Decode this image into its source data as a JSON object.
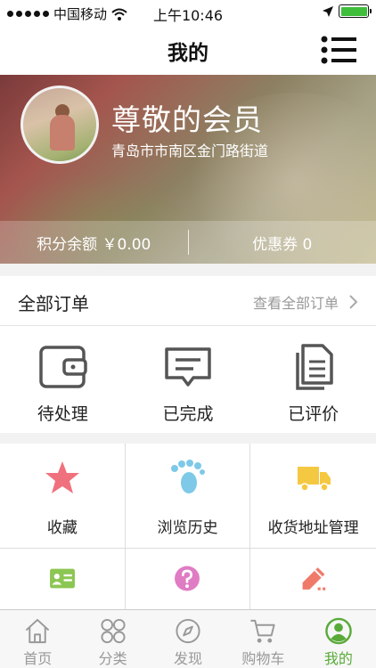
{
  "status_bar": {
    "carrier": "中国移动",
    "time": "上午10:46",
    "wifi_icon": "wifi-icon",
    "location_icon": "location-arrow-icon",
    "battery_icon": "battery-icon",
    "battery_level": 1.0
  },
  "header": {
    "title": "我的",
    "menu_icon": "list-menu-icon"
  },
  "profile": {
    "member_name": "尊敬的会员",
    "address": "青岛市市南区金门路街道",
    "points_balance": "积分余额 ￥0.00",
    "coupons": "优惠券 0"
  },
  "orders": {
    "title": "全部订单",
    "view_all": "查看全部订单",
    "statuses": [
      {
        "label": "待处理",
        "icon": "wallet-icon"
      },
      {
        "label": "已完成",
        "icon": "message-icon"
      },
      {
        "label": "已评价",
        "icon": "documents-icon"
      }
    ]
  },
  "grid": [
    {
      "label": "收藏",
      "icon": "star-icon",
      "color": "#f0717e"
    },
    {
      "label": "浏览历史",
      "icon": "footprint-icon",
      "color": "#7ec9e8"
    },
    {
      "label": "收货地址管理",
      "icon": "truck-icon",
      "color": "#f5c842"
    },
    {
      "label": "",
      "icon": "id-card-icon",
      "color": "#8cc653"
    },
    {
      "label": "",
      "icon": "question-icon",
      "color": "#e07cc4"
    },
    {
      "label": "",
      "icon": "pencil-icon",
      "color": "#f07a6a"
    }
  ],
  "tabs": [
    {
      "label": "首页",
      "icon": "home-icon",
      "active": false
    },
    {
      "label": "分类",
      "icon": "category-icon",
      "active": false
    },
    {
      "label": "发现",
      "icon": "compass-icon",
      "active": false
    },
    {
      "label": "购物车",
      "icon": "cart-icon",
      "active": false
    },
    {
      "label": "我的",
      "icon": "user-icon",
      "active": true
    }
  ],
  "colors": {
    "accent": "#5aaa3a",
    "icon_gray": "#555555"
  }
}
